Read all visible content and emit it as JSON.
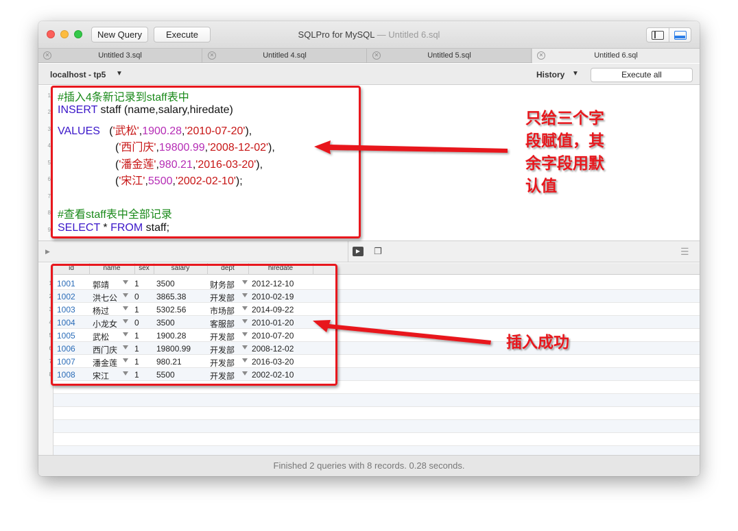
{
  "window": {
    "new_query_label": "New Query",
    "execute_label": "Execute",
    "app_title": "SQLPro for MySQL",
    "title_separator": " — ",
    "document_title": "Untitled 6.sql"
  },
  "tabs": [
    {
      "label": "Untitled 3.sql",
      "active": false
    },
    {
      "label": "Untitled 4.sql",
      "active": false
    },
    {
      "label": "Untitled 5.sql",
      "active": false
    },
    {
      "label": "Untitled 6.sql",
      "active": true
    }
  ],
  "connection": {
    "label": "localhost - tp5",
    "history_label": "History",
    "execute_all_label": "Execute all"
  },
  "editor": {
    "line_numbers": [
      "1",
      "2",
      "3",
      "4",
      "5",
      "6",
      "7",
      "8",
      "9"
    ],
    "lines": {
      "l1": "#插入4条新记录到staff表中",
      "l2_kw": "INSERT",
      "l2_rest": " staff (name,salary,hiredate)",
      "l3_kw": "VALUES",
      "l3_rest": "   (",
      "l3_s1": "'武松'",
      "l3_n": "1900.28",
      "l3_s2": "'2010-07-20'",
      "l3_end": "),",
      "l4_open": "(",
      "l4_s1": "'西门庆'",
      "l4_n": "19800.99",
      "l4_s2": "'2008-12-02'",
      "l4_end": "),",
      "l5_open": "(",
      "l5_s1": "'潘金莲'",
      "l5_n": "980.21",
      "l5_s2": "'2016-03-20'",
      "l5_end": "),",
      "l6_open": "(",
      "l6_s1": "'宋江'",
      "l6_n": "5500",
      "l6_s2": "'2002-02-10'",
      "l6_end": ");",
      "comma": ",",
      "l8": "#查看staff表中全部记录",
      "l9_kw1": "SELECT",
      "l9_mid": " * ",
      "l9_kw2": "FROM",
      "l9_rest": " staff;"
    }
  },
  "results": {
    "columns": [
      "id",
      "name",
      "sex",
      "salary",
      "dept",
      "hiredate"
    ],
    "row_numbers": [
      "1",
      "2",
      "3",
      "4",
      "5",
      "6",
      "7",
      "8"
    ],
    "rows": [
      {
        "id": "1001",
        "name": "郭靖",
        "sex": "1",
        "salary": "3500",
        "dept": "财务部",
        "hiredate": "2012-12-10"
      },
      {
        "id": "1002",
        "name": "洪七公",
        "sex": "0",
        "salary": "3865.38",
        "dept": "开发部",
        "hiredate": "2010-02-19"
      },
      {
        "id": "1003",
        "name": "杨过",
        "sex": "1",
        "salary": "5302.56",
        "dept": "市场部",
        "hiredate": "2014-09-22"
      },
      {
        "id": "1004",
        "name": "小龙女",
        "sex": "0",
        "salary": "3500",
        "dept": "客服部",
        "hiredate": "2010-01-20"
      },
      {
        "id": "1005",
        "name": "武松",
        "sex": "1",
        "salary": "1900.28",
        "dept": "开发部",
        "hiredate": "2010-07-20"
      },
      {
        "id": "1006",
        "name": "西门庆",
        "sex": "1",
        "salary": "19800.99",
        "dept": "开发部",
        "hiredate": "2008-12-02"
      },
      {
        "id": "1007",
        "name": "潘金莲",
        "sex": "1",
        "salary": "980.21",
        "dept": "开发部",
        "hiredate": "2016-03-20"
      },
      {
        "id": "1008",
        "name": "宋江",
        "sex": "1",
        "salary": "5500",
        "dept": "开发部",
        "hiredate": "2002-02-10"
      }
    ]
  },
  "status": {
    "text": "Finished 2 queries with 8 records. 0.28 seconds."
  },
  "annotations": {
    "top_note": [
      "只给三个字",
      "段赋值，其",
      "余字段用默",
      "认值"
    ],
    "bottom_note": "插入成功",
    "color": "#e8171d"
  },
  "icons": {
    "close": "close-icon",
    "run": "run-icon",
    "copy": "copy-icon",
    "menu": "menu-icon"
  }
}
